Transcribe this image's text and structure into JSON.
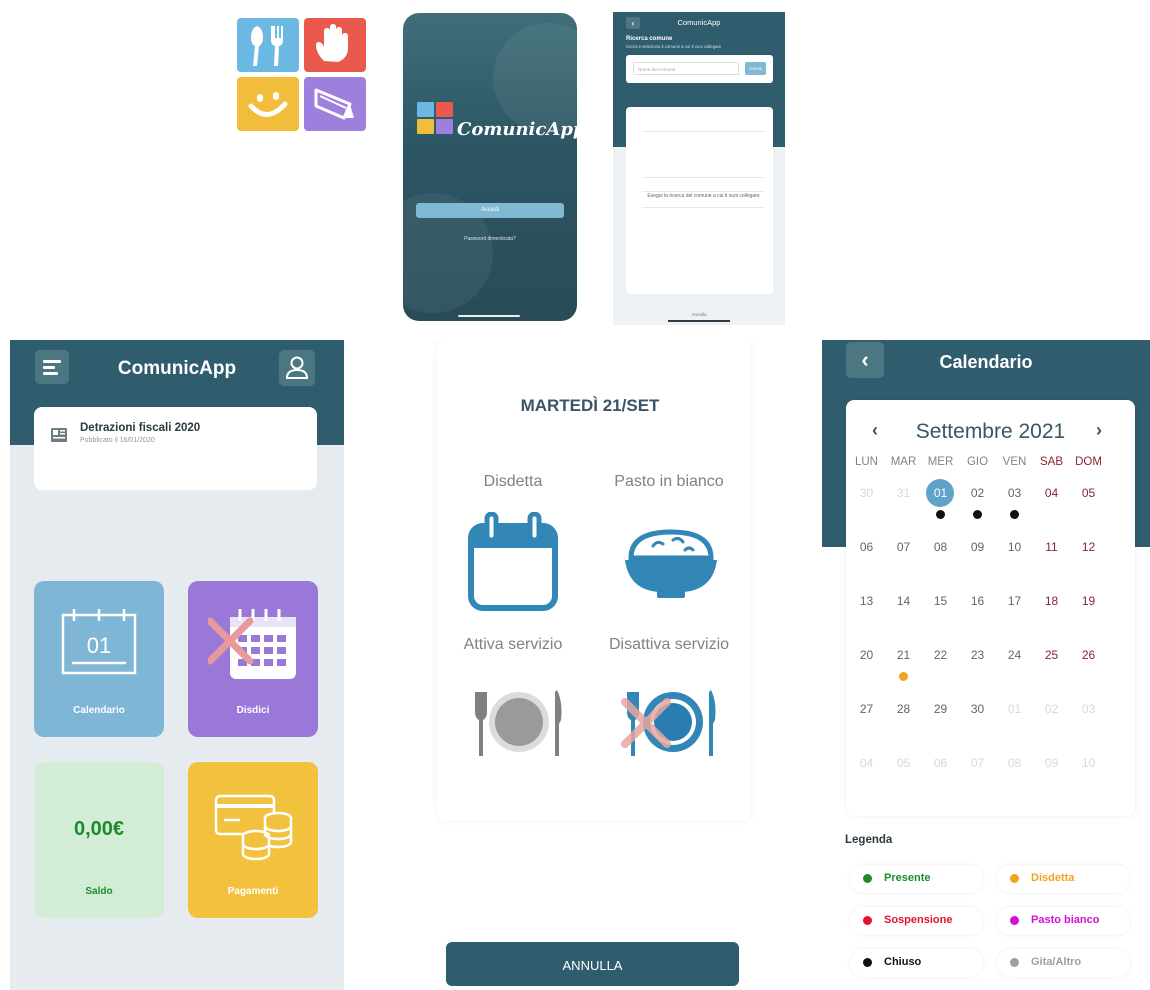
{
  "splash": {
    "brand": "ComunicApp",
    "login_button": "Accedi",
    "forgot_password": "Password dimenticata?"
  },
  "search": {
    "title": "ComunicApp",
    "heading": "Ricerca comune",
    "subheading": "Cerca e seleziona il comune a cui ti vuoi collegare",
    "input_placeholder": "Nome del comune",
    "search_button": "Cerca",
    "empty_message": "Esegui la ricerca del comune a cui ti vuoi collegare",
    "cancel": "Annulla"
  },
  "home": {
    "title": "ComunicApp",
    "news": {
      "title": "Detrazioni fiscali 2020",
      "subtitle": "Pubblicato il 16/01/2020"
    },
    "tiles": {
      "calendar": {
        "label": "Calendario",
        "day": "01"
      },
      "cancel": {
        "label": "Disdici"
      },
      "balance": {
        "label": "Saldo",
        "value": "0,00€"
      },
      "payments": {
        "label": "Pagamenti"
      }
    }
  },
  "meal": {
    "date": "MARTEDÌ 21/SET",
    "options": [
      "Disdetta",
      "Pasto in bianco",
      "Attiva servizio",
      "Disattiva servizio"
    ],
    "cancel_button": "ANNULLA"
  },
  "calendar": {
    "title": "Calendario",
    "month": "Settembre 2021",
    "weekdays": [
      "LUN",
      "MAR",
      "MER",
      "GIO",
      "VEN",
      "SAB",
      "DOM"
    ],
    "legend_title": "Legenda",
    "legend": [
      {
        "label": "Presente",
        "color": "#1e8c2a"
      },
      {
        "label": "Disdetta",
        "color": "#f0a51c"
      },
      {
        "label": "Sospensione",
        "color": "#e0142c"
      },
      {
        "label": "Pasto bianco",
        "color": "#d20fd2"
      },
      {
        "label": "Chiuso",
        "color": "#111111"
      },
      {
        "label": "Gita/Altro",
        "color": "#9aa0a3"
      }
    ]
  },
  "colors": {
    "primary": "#2f5d6d",
    "accent": "#5fa3c9",
    "tile_calendar": "#7fb6d6",
    "tile_cancel": "#9a78d8",
    "tile_balance": "#d3ecd5",
    "tile_payments": "#f2c23e"
  }
}
